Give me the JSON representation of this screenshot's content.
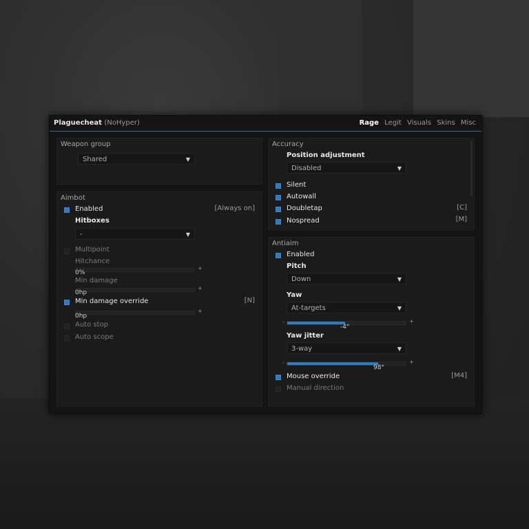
{
  "window": {
    "title": "Plaguecheat",
    "subtitle": "(NoHyper)",
    "tabs": [
      {
        "label": "Rage",
        "active": true
      },
      {
        "label": "Legit",
        "active": false
      },
      {
        "label": "Visuals",
        "active": false
      },
      {
        "label": "Skins",
        "active": false
      },
      {
        "label": "Misc",
        "active": false
      }
    ],
    "accent_color": "#2e7bbf"
  },
  "weapon_group": {
    "title": "Weapon group",
    "select_value": "Shared"
  },
  "aimbot": {
    "title": "Aimbot",
    "enabled_label": "Enabled",
    "enabled_key": "[Always on]",
    "hitboxes_label": "Hitboxes",
    "hitboxes_value": "-",
    "multipoint_label": "Multipoint",
    "hitchance_label": "Hitchance",
    "hitchance_value": "0%",
    "min_damage_label": "Min damage",
    "min_damage_value": "0hp",
    "min_damage_override_label": "Min damage override",
    "min_damage_override_key": "[N]",
    "min_damage_override_value": "0hp",
    "auto_stop_label": "Auto stop",
    "auto_scope_label": "Auto scope",
    "plus": "+"
  },
  "accuracy": {
    "title": "Accuracy",
    "position_adjustment_label": "Position adjustment",
    "position_adjustment_value": "Disabled",
    "silent_label": "Silent",
    "autowall_label": "Autowall",
    "doubletap_label": "Doubletap",
    "doubletap_key": "[C]",
    "nospread_label": "Nospread",
    "nospread_key": "[M]"
  },
  "antiaim": {
    "title": "Antiaim",
    "enabled_label": "Enabled",
    "pitch_label": "Pitch",
    "pitch_value": "Down",
    "yaw_label": "Yaw",
    "yaw_value": "At-targets",
    "yaw_slider_value": "-4°",
    "yaw_slider_fraction": 0.49,
    "yaw_jitter_label": "Yaw jitter",
    "yaw_jitter_value": "3-way",
    "yaw_jitter_slider_value": "98°",
    "yaw_jitter_slider_fraction": 0.77,
    "mouse_override_label": "Mouse override",
    "mouse_override_key": "[M4]",
    "manual_direction_label": "Manual direction",
    "minus": "-",
    "plus": "+"
  }
}
